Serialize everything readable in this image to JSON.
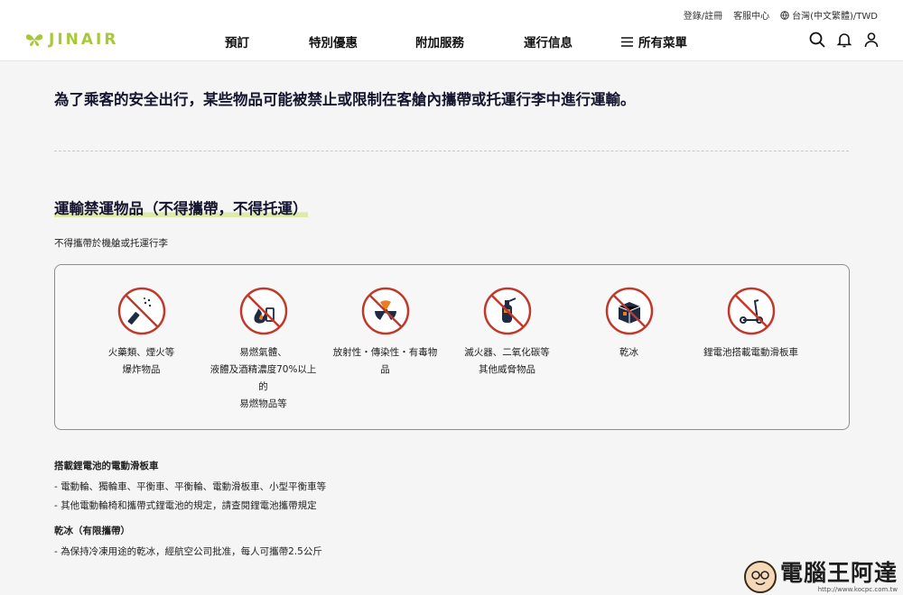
{
  "header": {
    "logo_text": "JINAIR",
    "util_links": [
      "登錄/註冊",
      "客服中心",
      "台灣(中文繁體)/TWD"
    ],
    "nav": [
      "預訂",
      "特別優惠",
      "附加服務",
      "運行信息",
      "所有菜單"
    ],
    "brand_color": "#a8c83a"
  },
  "main": {
    "intro": "為了乘客的安全出行，某些物品可能被禁止或限制在客艙內攜帶或托運行李中進行運輸。",
    "section_title": "運輸禁運物品（不得攜帶，不得托運）",
    "section_sub": "不得攜帶於機艙或托運行李",
    "items": [
      {
        "icon": "fireworks-icon",
        "label": "火藥類、煙火等\n爆炸物品"
      },
      {
        "icon": "flammable-icon",
        "label": "易燃氣體、\n液體及酒精濃度70%以上\n的\n易燃物品等"
      },
      {
        "icon": "radioactive-icon",
        "label": "放射性・傳染性・有毒物\n品"
      },
      {
        "icon": "fire-extinguisher-icon",
        "label": "滅火器、二氧化碳等\n其他威脅物品"
      },
      {
        "icon": "dry-ice-icon",
        "label": "乾冰"
      },
      {
        "icon": "electric-scooter-icon",
        "label": "鋰電池搭載電動滑板車"
      }
    ],
    "prohibited_color": "#c0392b",
    "notes": [
      {
        "title": "搭載鋰電池的電動滑板車",
        "lines": [
          "- 電動輪、獨輪車、平衡車、平衡輪、電動滑板車、小型平衡車等",
          "- 其他電動輪椅和攜帶式鋰電池的規定，請查閱鋰電池攜帶規定"
        ]
      },
      {
        "title": "乾冰（有限攜帶）",
        "lines": [
          "- 為保持冷凍用途的乾冰，經航空公司批准，每人可攜帶2.5公斤"
        ]
      }
    ]
  },
  "watermark": {
    "text": "電腦王阿達",
    "url": "http://www.kocpc.com.tw"
  }
}
